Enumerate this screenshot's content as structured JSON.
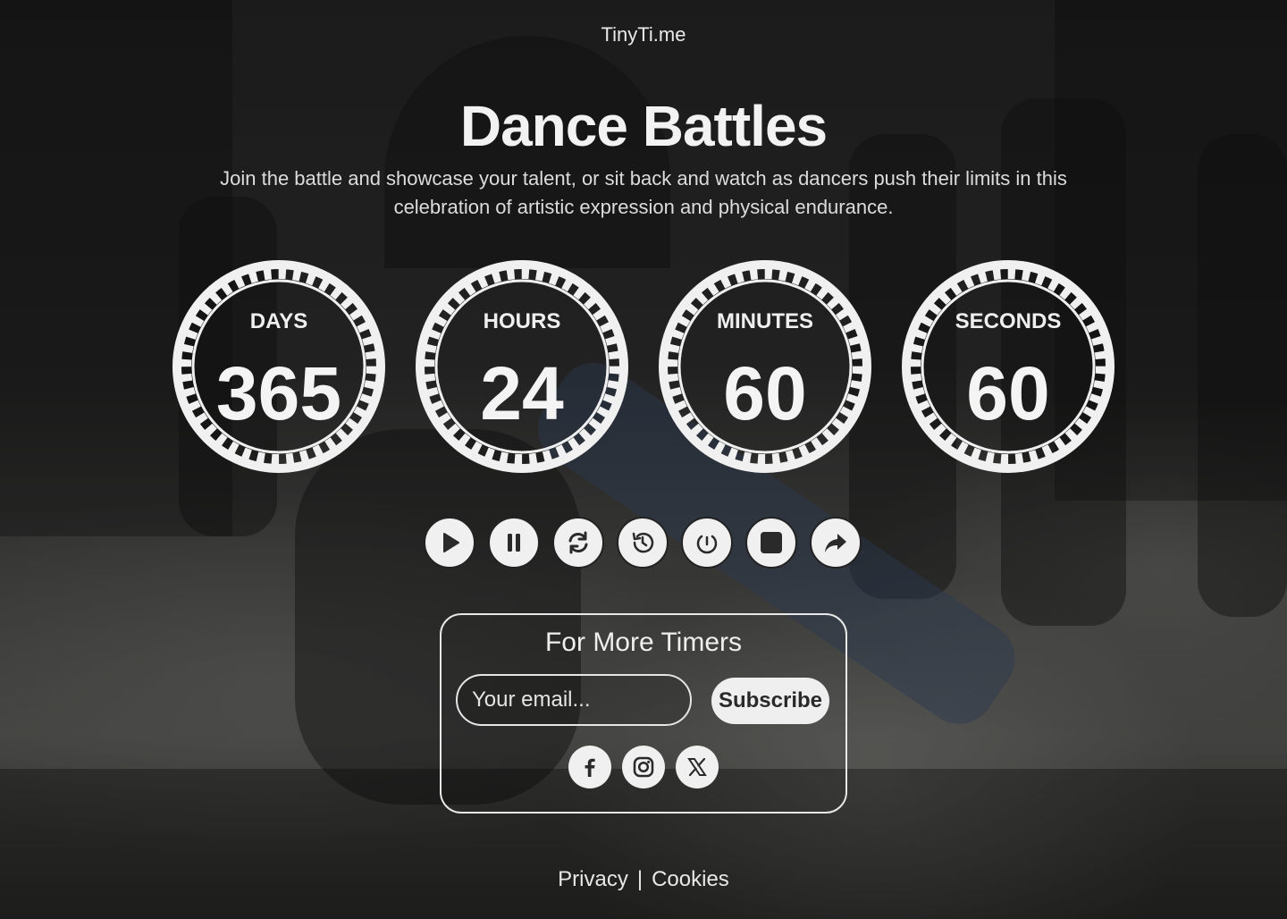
{
  "brand": "TinyTi.me",
  "event": {
    "title": "Dance Battles",
    "description": "Join the battle and showcase your talent, or sit back and watch as dancers push their limits in this celebration of artistic expression and physical endurance."
  },
  "countdown": [
    {
      "unit": "DAYS",
      "value": "365"
    },
    {
      "unit": "HOURS",
      "value": "24"
    },
    {
      "unit": "MINUTES",
      "value": "60"
    },
    {
      "unit": "SECONDS",
      "value": "60"
    }
  ],
  "controls": [
    {
      "name": "play-button",
      "icon": "play-icon"
    },
    {
      "name": "pause-button",
      "icon": "pause-icon"
    },
    {
      "name": "reset-button",
      "icon": "refresh-icon"
    },
    {
      "name": "history-button",
      "icon": "history-icon"
    },
    {
      "name": "restart-button",
      "icon": "restart-icon"
    },
    {
      "name": "stop-button",
      "icon": "stop-icon"
    },
    {
      "name": "share-button",
      "icon": "share-icon"
    }
  ],
  "subscribe": {
    "heading": "For More Timers",
    "email_placeholder": "Your email...",
    "button_label": "Subscribe"
  },
  "social": [
    {
      "name": "facebook",
      "icon": "facebook-icon"
    },
    {
      "name": "instagram",
      "icon": "instagram-icon"
    },
    {
      "name": "x",
      "icon": "x-icon"
    }
  ],
  "footer": {
    "privacy": "Privacy",
    "separator": "|",
    "cookies": "Cookies"
  },
  "colors": {
    "text": "#f2f2f2",
    "button_bg": "#f0f0f0",
    "icon": "#2a2a2a"
  }
}
